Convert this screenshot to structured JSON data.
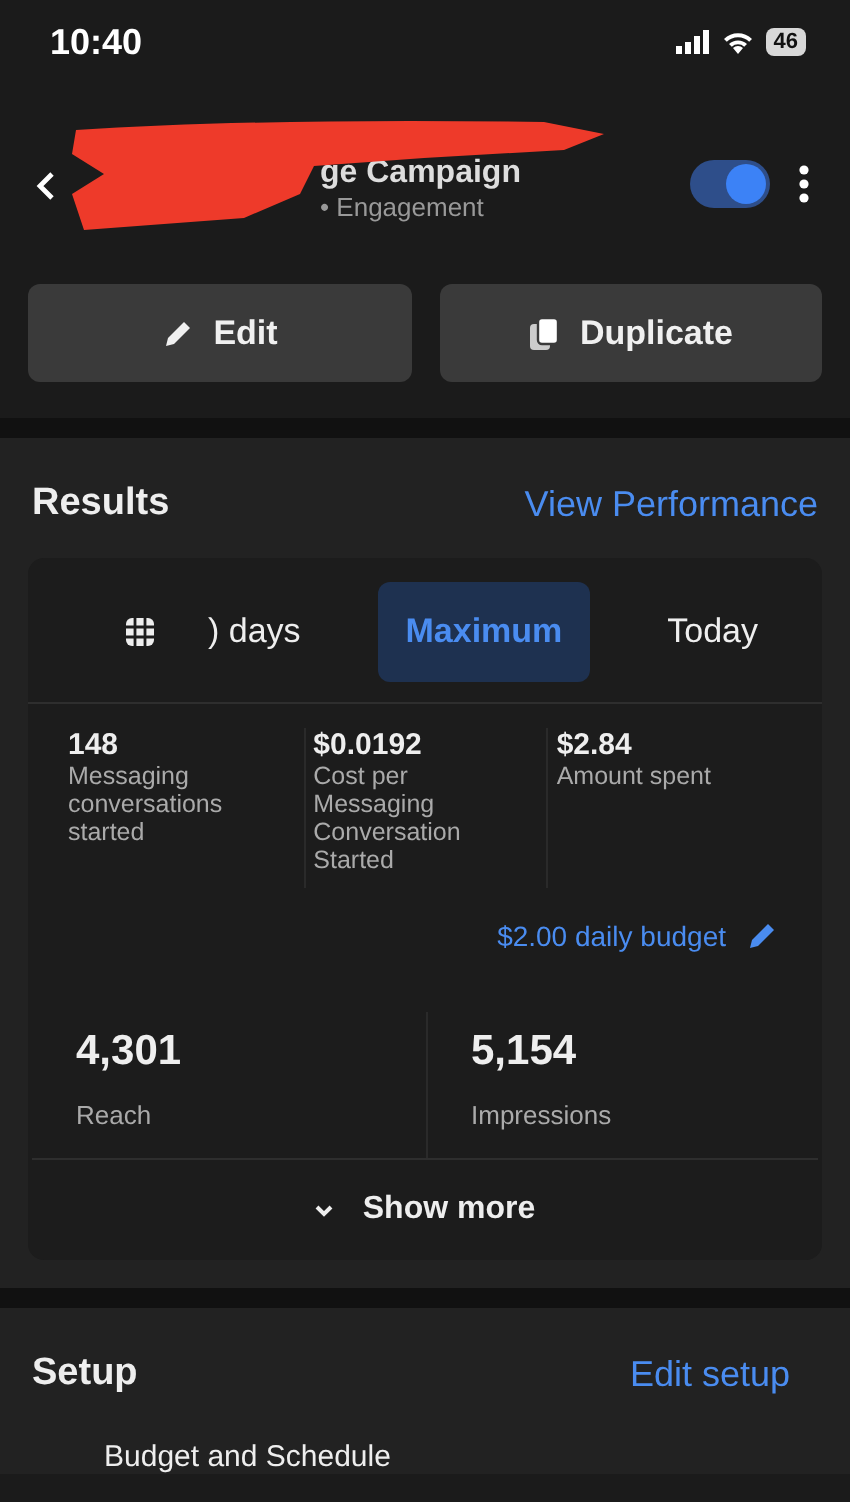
{
  "status_bar": {
    "time": "10:40",
    "battery": "46"
  },
  "header": {
    "title": "ge Campaign",
    "subtitle": "• Engagement",
    "toggle": {
      "on": true
    }
  },
  "actions": [
    {
      "label": "Edit",
      "kind": "edit"
    },
    {
      "label": "Duplicate",
      "kind": "duplicate"
    }
  ],
  "results": {
    "title": "Results",
    "link": "View Performance",
    "tabs": [
      {
        "label": ") days",
        "kind": "calendar",
        "selected": false
      },
      {
        "label": "Maximum",
        "kind": "plain",
        "selected": true
      },
      {
        "label": "Today",
        "kind": "plain",
        "selected": false
      }
    ],
    "metrics": [
      {
        "value": "148",
        "label": "Messaging conversations started"
      },
      {
        "value": "$0.0192",
        "label": "Cost per Messaging Conversation Started"
      },
      {
        "value": "$2.84",
        "label": "Amount spent"
      }
    ],
    "budget": "$2.00 daily budget",
    "totals": [
      {
        "value": "4,301",
        "label": "Reach"
      },
      {
        "value": "5,154",
        "label": "Impressions"
      }
    ],
    "show_more": "Show more"
  },
  "setup": {
    "title": "Setup",
    "link": "Edit setup",
    "first_item": "Budget and Schedule"
  }
}
